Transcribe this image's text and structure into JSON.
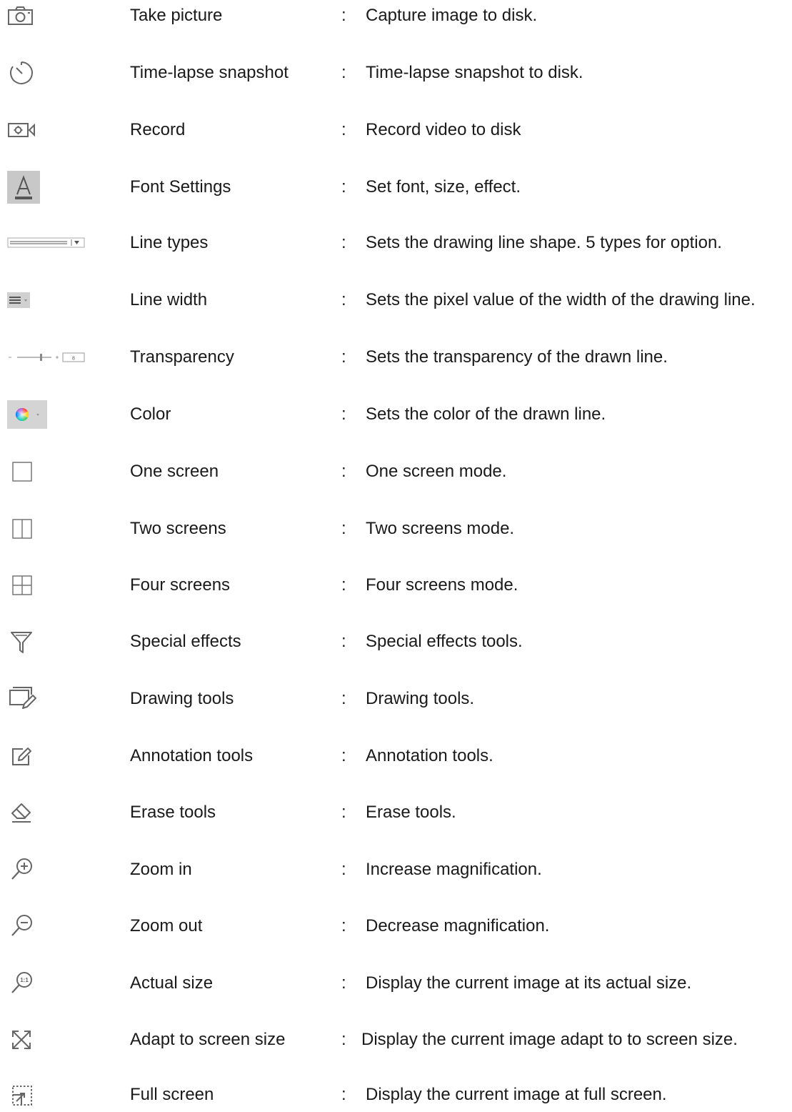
{
  "rows": [
    {
      "icon": "camera-icon",
      "label": "Take picture",
      "colon": ":",
      "desc": "Capture image to disk."
    },
    {
      "icon": "timer-icon",
      "label": "Time-lapse snapshot",
      "colon": ":",
      "desc": "Time-lapse snapshot to disk."
    },
    {
      "icon": "video-record-icon",
      "label": "Record",
      "colon": ":",
      "desc": "Record video to disk"
    },
    {
      "icon": "font-icon",
      "label": "Font Settings",
      "colon": ":",
      "desc": "Set font, size, effect."
    },
    {
      "icon": "line-type-dropdown-icon",
      "label": "Line types",
      "colon": ":",
      "desc": "Sets the drawing line shape. 5 types for option."
    },
    {
      "icon": "line-width-icon",
      "label": "Line width",
      "colon": ":",
      "desc": "Sets the pixel value of the width of the drawing line."
    },
    {
      "icon": "transparency-slider-icon",
      "label": "Transparency",
      "colon": ":",
      "desc": "Sets the transparency of the drawn line.",
      "slider_value": "8"
    },
    {
      "icon": "color-wheel-icon",
      "label": "Color",
      "colon": ":",
      "desc": "Sets the color of the drawn line."
    },
    {
      "icon": "one-screen-icon",
      "label": "One screen",
      "colon": ":",
      "desc": "One screen mode."
    },
    {
      "icon": "two-screens-icon",
      "label": "Two screens",
      "colon": ":",
      "desc": "Two screens mode."
    },
    {
      "icon": "four-screens-icon",
      "label": "Four screens",
      "colon": ":",
      "desc": "Four screens mode."
    },
    {
      "icon": "filter-icon",
      "label": "Special effects",
      "colon": ":",
      "desc": "Special effects tools."
    },
    {
      "icon": "drawing-tools-icon",
      "label": "Drawing tools",
      "colon": ":",
      "desc": "Drawing tools."
    },
    {
      "icon": "annotation-icon",
      "label": "Annotation tools",
      "colon": ":",
      "desc": "Annotation tools."
    },
    {
      "icon": "eraser-icon",
      "label": "Erase tools",
      "colon": ":",
      "desc": "Erase tools."
    },
    {
      "icon": "zoom-in-icon",
      "label": "Zoom in",
      "colon": ":",
      "desc": "Increase magnification."
    },
    {
      "icon": "zoom-out-icon",
      "label": "Zoom out",
      "colon": ":",
      "desc": "Decrease magnification."
    },
    {
      "icon": "actual-size-icon",
      "label": "Actual size",
      "colon": ":",
      "desc": "Display the current image at its actual size.",
      "icon_text": "1:1"
    },
    {
      "icon": "fit-screen-icon",
      "label": "Adapt to screen size",
      "colon": ":",
      "desc": "Display the current image adapt to to screen size."
    },
    {
      "icon": "full-screen-icon",
      "label": "Full screen",
      "colon": ":",
      "desc": "Display the current image at full screen."
    }
  ],
  "colors": {
    "icon_stroke": "#666666",
    "icon_bg": "#c8c8c8",
    "text": "#1a1a1a"
  }
}
